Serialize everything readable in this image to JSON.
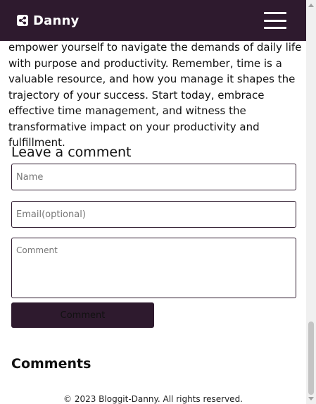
{
  "header": {
    "brand": "Danny",
    "logo_icon": "share-icon",
    "menu_icon": "hamburger-menu-icon",
    "background_color": "#2e1a2e"
  },
  "article": {
    "text": "empower yourself to navigate the demands of daily life with purpose and productivity. Remember, time is a valuable resource, and how you manage it shapes the trajectory of your success. Start today, embrace effective time management, and witness the transformative impact on your productivity and fulfillment."
  },
  "comment_form": {
    "heading": "Leave a comment",
    "name_placeholder": "Name",
    "email_placeholder": "Email(optional)",
    "comment_placeholder": "Comment",
    "submit_label": "Comment"
  },
  "comments": {
    "heading": "Comments"
  },
  "footer": {
    "text": "© 2023 Bloggit-Danny. All rights reserved."
  }
}
